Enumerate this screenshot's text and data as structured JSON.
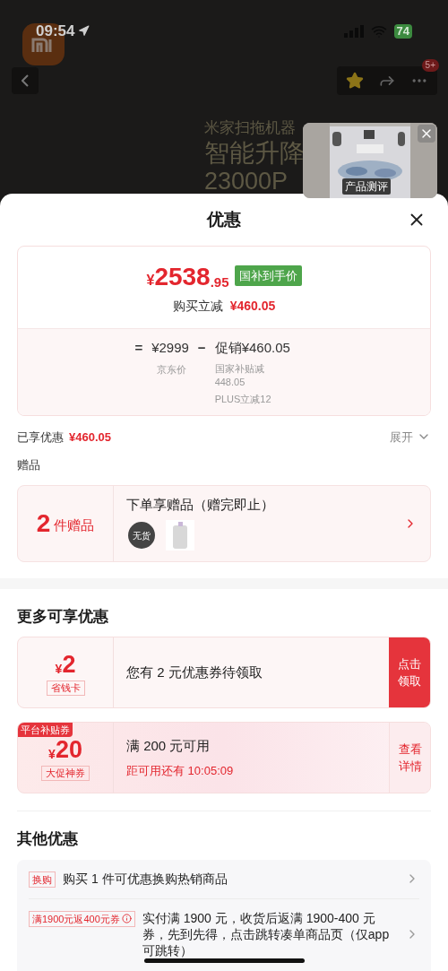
{
  "status_bar": {
    "time": "09:54",
    "battery": "74"
  },
  "header": {
    "badge": "5+",
    "favorited": true
  },
  "banner": {
    "lines": [
      "米家扫拖机器",
      "智能升降",
      "23000P"
    ]
  },
  "video": {
    "caption": "产品测评"
  },
  "sheet": {
    "title": "优惠"
  },
  "price_card": {
    "currency": "¥",
    "integer": "2538",
    "decimal": ".95",
    "tag": "国补到手价",
    "saving_label": "购买立减",
    "saving_value": "¥460.05",
    "equals": "=",
    "base_price": "¥2999",
    "base_label": "京东价",
    "minus": "−",
    "promo": "促销¥460.05",
    "promo_details": [
      "国家补贴减\n448.05",
      "PLUS立减12"
    ]
  },
  "enjoyed": {
    "label": "已享优惠",
    "value": "¥460.05",
    "toggle": "展开",
    "expanded": false
  },
  "gifts": {
    "heading": "赠品",
    "count": "2",
    "count_label": "件赠品",
    "title": "下单享赠品（赠完即止）",
    "items": [
      {
        "kind": "round",
        "stock_label": "无货"
      },
      {
        "kind": "bottle"
      }
    ]
  },
  "more": {
    "heading": "更多可享优惠",
    "coupons": [
      {
        "kind": "claim",
        "currency": "¥",
        "amount": "2",
        "badge": "省钱卡",
        "title": "您有 2 元优惠券待领取",
        "action": [
          "点击",
          "领取"
        ]
      },
      {
        "kind": "detail",
        "corner": "平台补贴券",
        "currency": "¥",
        "amount": "20",
        "badge": "大促神券",
        "title": "满 200 元可用",
        "subtitle": "距可用还有 10:05:09",
        "action": [
          "查看",
          "详情"
        ]
      }
    ]
  },
  "other": {
    "heading": "其他优惠",
    "items": [
      {
        "tag": "换购",
        "info": false,
        "text": "购买 1 件可优惠换购热销商品"
      },
      {
        "tag": "满1900元返400元券",
        "info": true,
        "text": "实付满 1900 元，收货后返满 1900-400 元券，先到先得，点击跳转凑单商品页（仅app 可跳转）"
      }
    ]
  }
}
